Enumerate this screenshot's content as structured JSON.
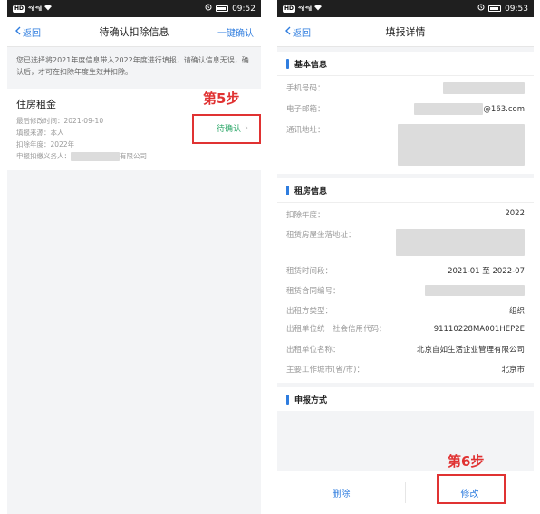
{
  "left": {
    "statusbar": {
      "chip": "HD",
      "signal": "⁴⁶ıll ⁴⁶ıll",
      "time": "09:52"
    },
    "nav": {
      "back_label": "返回",
      "title": "待确认扣除信息",
      "action_label": "一键确认"
    },
    "notice": "您已选择将2021年度信息带入2022年度进行填报，请确认信息无误，确认后，才可在扣除年度生效并扣除。",
    "card": {
      "title": "住房租金",
      "last_modified_label": "最后修改时间：",
      "last_modified_value": "2021-09-10",
      "source_label": "填报来源：",
      "source_value": "本人",
      "year_label": "扣除年度：",
      "year_value": "2022年",
      "agent_label": "申报扣缴义务人：",
      "agent_suffix": "有限公司",
      "status": "待确认",
      "chevron": "›"
    },
    "step_label": "第5步"
  },
  "right": {
    "statusbar": {
      "chip": "HD",
      "signal": "⁴⁶ıll ⁴⁶ıll",
      "time": "09:53"
    },
    "nav": {
      "back_label": "返回",
      "title": "填报详情"
    },
    "basic": {
      "heading": "基本信息",
      "phone_label": "手机号码：",
      "email_label": "电子邮箱：",
      "email_suffix": "@163.com",
      "address_label": "通讯地址："
    },
    "rent": {
      "heading": "租房信息",
      "year_label": "扣除年度：",
      "year_value": "2022",
      "location_label": "租赁房屋坐落地址：",
      "period_label": "租赁时间段：",
      "period_value": "2021-01 至 2022-07",
      "contract_label": "租赁合同编号：",
      "lessor_type_label": "出租方类型：",
      "lessor_type_value": "组织",
      "credit_code_label": "出租单位统一社会信用代码：",
      "credit_code_value": "91110228MA001HEP2E",
      "lessor_name_label": "出租单位名称：",
      "lessor_name_value": "北京自如生活企业管理有限公司",
      "city_label": "主要工作城市(省/市)：",
      "city_value": "北京市"
    },
    "declare": {
      "heading": "申报方式"
    },
    "buttons": {
      "delete_label": "删除",
      "edit_label": "修改"
    },
    "step_label": "第6步"
  },
  "colors": {
    "accent": "#2f7ddf",
    "annotation": "#e03232",
    "status_green": "#2ea86a"
  }
}
